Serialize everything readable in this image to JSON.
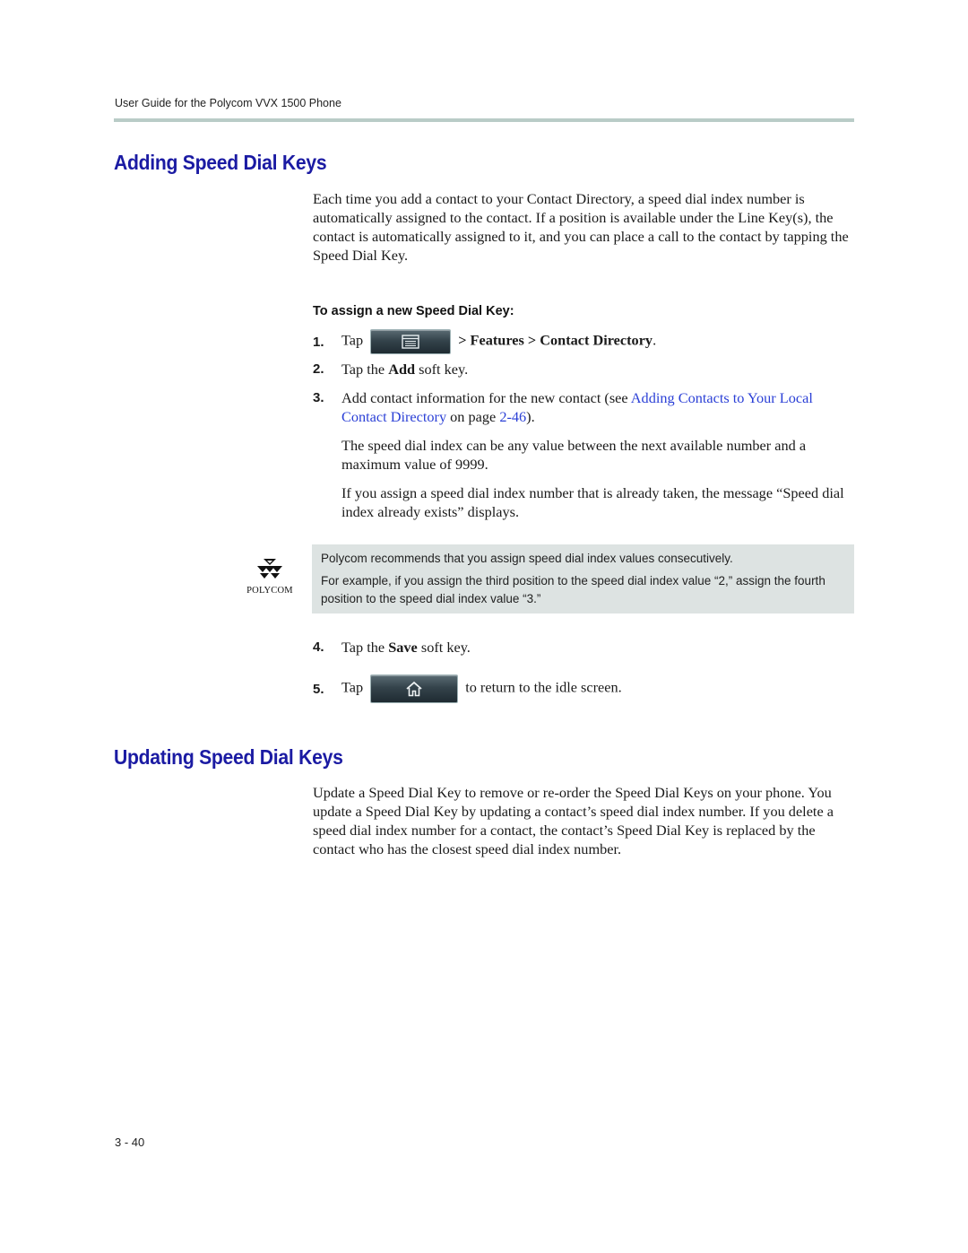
{
  "header": {
    "running_title": "User Guide for the Polycom VVX 1500 Phone"
  },
  "section1": {
    "title": "Adding Speed Dial Keys",
    "intro": "Each time you add a contact to your Contact Directory, a speed dial index number is automatically assigned to the contact. If a position is available under the Line Key(s), the contact is automatically assigned to it, and you can place a call to the contact by tapping the Speed Dial Key.",
    "procedure_heading": "To assign a new Speed Dial Key:",
    "steps": [
      {
        "number": "1.",
        "pre": "Tap",
        "button_icon": "menu-icon",
        "post": "> Features > Contact Directory",
        "end": "."
      },
      {
        "number": "2.",
        "pre": "Tap the ",
        "bold": "Add",
        "post": " soft key."
      },
      {
        "number": "3.",
        "pre": "Add contact information for the new contact (see ",
        "link": "Adding Contacts to Your Local Contact Directory",
        "mid": " on page ",
        "page_link": "2-46",
        "post": ").",
        "extra_paragraphs": [
          "The speed dial index can be any value between the next available number and a maximum value of 9999.",
          "If you assign a speed dial index number that is already taken, the message “Speed dial index already exists” displays."
        ]
      },
      {
        "number": "4.",
        "pre": "Tap the ",
        "bold": "Save",
        "post": " soft key."
      },
      {
        "number": "5.",
        "pre": "Tap",
        "button_icon": "home-icon",
        "post": "to return to the idle screen."
      }
    ],
    "note": {
      "logo_text": "POLYCOM",
      "line1": "Polycom recommends that you assign speed dial index values consecutively.",
      "line2": "For example, if you assign the third position to the speed dial index value “2,” assign the fourth position to the speed dial index value “3.”"
    }
  },
  "section2": {
    "title": "Updating Speed Dial Keys",
    "body": "Update a Speed Dial Key to remove or re-order the Speed Dial Keys on your phone. You update a Speed Dial Key by updating a contact’s speed dial index number. If you delete a speed dial index number for a contact, the contact’s Speed Dial Key is replaced by the contact who has the closest speed dial index number."
  },
  "footer": {
    "page_number": "3 - 40"
  },
  "colors": {
    "heading": "#1b1ba3",
    "link": "#2a3fd6",
    "rule": "#b9ccc7",
    "note_bg": "#dde3e2"
  }
}
